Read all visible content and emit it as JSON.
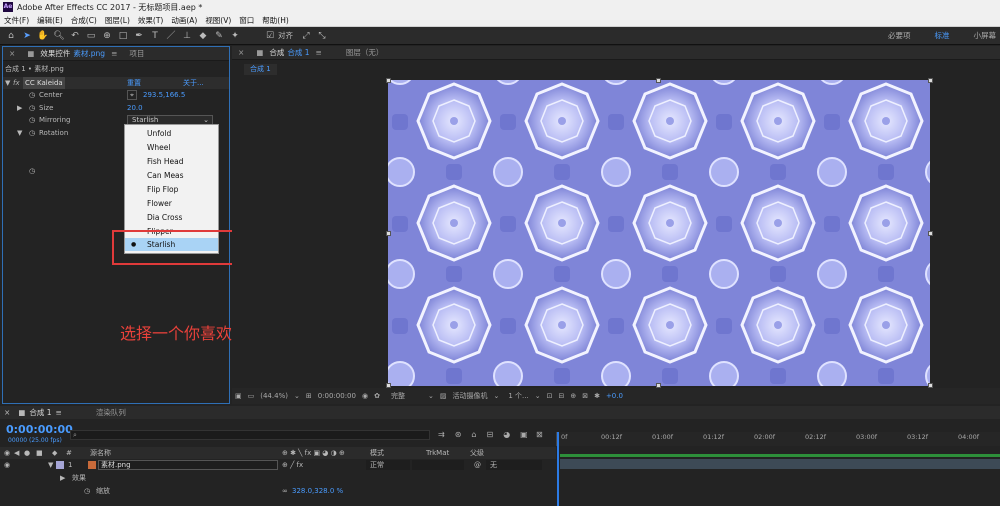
{
  "app": {
    "title": "Adobe After Effects CC 2017 - 无标题项目.aep *",
    "logo": "Ae"
  },
  "menu": [
    "文件(F)",
    "编辑(E)",
    "合成(C)",
    "图层(L)",
    "效果(T)",
    "动画(A)",
    "视图(V)",
    "窗口",
    "帮助(H)"
  ],
  "toolbar": {
    "align_label": "对齐",
    "workspaces": [
      "必要项",
      "标准",
      "小屏幕"
    ],
    "active_workspace": "标准"
  },
  "effects_panel": {
    "tab_label": "效果控件",
    "tab_file": "素材.png",
    "tab_project": "项目",
    "breadcrumb": "合成 1 • 素材.png",
    "effect_name": "CC Kaleida",
    "reset": "重置",
    "about": "关于...",
    "props": [
      {
        "name": "Center",
        "value": "293.5,166.5"
      },
      {
        "name": "Size",
        "value": "20.0"
      },
      {
        "name": "Mirroring",
        "value": "Starlish"
      },
      {
        "name": "Rotation",
        "value": ""
      }
    ]
  },
  "dropdown": {
    "options": [
      "Unfold",
      "Wheel",
      "Fish Head",
      "Can Meas",
      "Flip Flop",
      "Flower",
      "Dia Cross",
      "Flipper",
      "Starlish"
    ],
    "selected": "Starlish"
  },
  "annotation": {
    "caption": "选择一个你喜欢的效果样式"
  },
  "comp_panel": {
    "tab_label": "合成",
    "tab_comp": "合成 1",
    "layer_tab": "图层（无）",
    "sub_tab": "合成 1"
  },
  "viewer_bar": {
    "zoom": "(44.4%)",
    "timecode": "0:00:00:00",
    "quality": "完整",
    "camera": "活动摄像机",
    "views": "1 个...",
    "exposure": "+0.0"
  },
  "timeline": {
    "tab": "合成 1",
    "render_queue": "渲染队列",
    "timecode": "0:00:00:00",
    "frame_info": "00000 (25.00 fps)",
    "columns": {
      "source_name": "源名称",
      "mode": "模式",
      "trkmat": "TrkMat",
      "parent": "父级"
    },
    "ruler_ticks": [
      "0f",
      "00:12f",
      "01:00f",
      "01:12f",
      "02:00f",
      "02:12f",
      "03:00f",
      "03:12f",
      "04:00f"
    ],
    "layer": {
      "index": "1",
      "name": "素材.png",
      "mode": "正常",
      "parent": "无"
    },
    "effects_label": "效果",
    "scale_label": "缩放",
    "scale_value": "328.0,328.0 %"
  }
}
